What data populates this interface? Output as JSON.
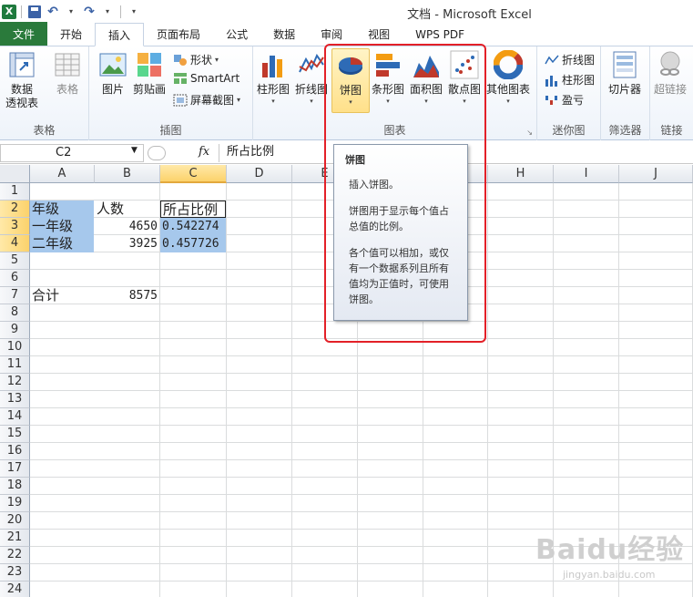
{
  "window": {
    "title": "文档 - Microsoft Excel",
    "qat": {
      "excel_logo": "X"
    }
  },
  "tabs": [
    "文件",
    "开始",
    "插入",
    "页面布局",
    "公式",
    "数据",
    "审阅",
    "视图",
    "WPS PDF"
  ],
  "active_tab": "插入",
  "ribbon": {
    "groups": {
      "table": {
        "label": "表格",
        "pivot": "数据\n透视表",
        "pivot_line1": "数据",
        "pivot_line2": "透视表",
        "table": "表格"
      },
      "illustrations": {
        "label": "插图",
        "picture": "图片",
        "clipart": "剪贴画",
        "shapes": "形状",
        "smartart": "SmartArt",
        "screenshot": "屏幕截图"
      },
      "charts": {
        "label": "图表",
        "column": "柱形图",
        "line": "折线图",
        "pie": "饼图",
        "bar": "条形图",
        "area": "面积图",
        "scatter": "散点图",
        "other": "其他图表"
      },
      "sparklines": {
        "label": "迷你图",
        "line": "折线图",
        "column": "柱形图",
        "winloss": "盈亏"
      },
      "filter": {
        "label": "筛选器",
        "slicer": "切片器"
      },
      "links": {
        "label": "链接",
        "hyperlink": "超链接"
      }
    }
  },
  "formula_bar": {
    "name_box": "C2",
    "fx": "fx",
    "formula": "所占比例"
  },
  "columns": [
    "A",
    "B",
    "C",
    "D",
    "E",
    "F",
    "G",
    "H",
    "I",
    "J"
  ],
  "rows": [
    "1",
    "2",
    "3",
    "4",
    "5",
    "6",
    "7",
    "8",
    "9",
    "10",
    "11",
    "12",
    "13",
    "14",
    "15",
    "16",
    "17",
    "18",
    "19",
    "20",
    "21",
    "22",
    "23",
    "24"
  ],
  "cells": {
    "A2": "年级",
    "B2": "人数",
    "C2": "所占比例",
    "A3": "一年级",
    "B3": "4650",
    "C3": "0.542274",
    "A4": "二年级",
    "B4": "3925",
    "C4": "0.457726",
    "A7": "合计",
    "B7": "8575"
  },
  "tooltip": {
    "title": "饼图",
    "line1": "插入饼图。",
    "line2": "饼图用于显示每个值占总值的比例。",
    "line3": "各个值可以相加，或仅有一个数据系列且所有值均为正值时，可使用饼图。"
  },
  "watermark": {
    "main": "Baidu经验",
    "sub": "jingyan.baidu.com"
  },
  "colors": {
    "file_tab": "#2a7a3b",
    "selection": "#a6c8ec",
    "highlight_box": "#e32028",
    "selected_header": "#fcd26b"
  }
}
